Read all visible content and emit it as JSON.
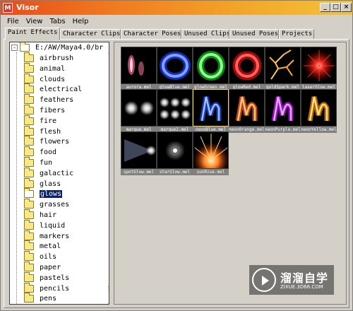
{
  "window": {
    "title": "Visor",
    "icon_letter": "M",
    "controls": [
      "_",
      "□",
      "×"
    ]
  },
  "menu": [
    "File",
    "View",
    "Tabs",
    "Help"
  ],
  "tabs": [
    {
      "label": "Paint Effects",
      "active": true
    },
    {
      "label": "Character Clips",
      "active": false
    },
    {
      "label": "Character Poses",
      "active": false
    },
    {
      "label": "Unused Clips",
      "active": false
    },
    {
      "label": "Unused Poses",
      "active": false
    },
    {
      "label": "Projects",
      "active": false
    }
  ],
  "tree": {
    "root": "E:/AW/Maya4.0/br",
    "root_toggle": "-",
    "items": [
      "airbrush",
      "animal",
      "clouds",
      "electrical",
      "feathers",
      "fibers",
      "fire",
      "flesh",
      "flowers",
      "food",
      "fun",
      "galactic",
      "glass",
      "glows",
      "grasses",
      "hair",
      "liquid",
      "markers",
      "metal",
      "oils",
      "paper",
      "pastels",
      "pencils",
      "pens"
    ],
    "selected": "glows"
  },
  "scrollbar": {
    "up": "▲",
    "down": "▼"
  },
  "thumbnails": [
    {
      "name": "aurora.mel",
      "icon": "aurora-glow"
    },
    {
      "name": "glowBlue.mel",
      "icon": "blue-ring"
    },
    {
      "name": "glowGreen.mel",
      "icon": "green-ring"
    },
    {
      "name": "glowRed.mel",
      "icon": "red-ring"
    },
    {
      "name": "goldSpark.mel",
      "icon": "gold-sparks"
    },
    {
      "name": "laserGlow.mel",
      "icon": "red-burst"
    },
    {
      "name": "marque.mel",
      "icon": "two-lights"
    },
    {
      "name": "marque2.mel",
      "icon": "six-lights"
    },
    {
      "name": "neonBlue.mel",
      "icon": "neon-blue-squiggle"
    },
    {
      "name": "neonOrange.mel",
      "icon": "neon-orange-squiggle"
    },
    {
      "name": "neonPurple.mel",
      "icon": "neon-purple-squiggle"
    },
    {
      "name": "neonYellow.mel",
      "icon": "neon-yellow-squiggle"
    },
    {
      "name": "spotGlow.mel",
      "icon": "spotlight"
    },
    {
      "name": "starGlow.mel",
      "icon": "star-glow"
    },
    {
      "name": "sunRise.mel",
      "icon": "sunrise"
    }
  ],
  "watermark": {
    "title": "溜溜自学",
    "url": "ZIXUE.3D66.COM"
  },
  "colors": {
    "title_start": "#e84c1a",
    "title_end": "#f4c23a",
    "selection": "#0a246a",
    "chrome": "#d4d0c8"
  }
}
